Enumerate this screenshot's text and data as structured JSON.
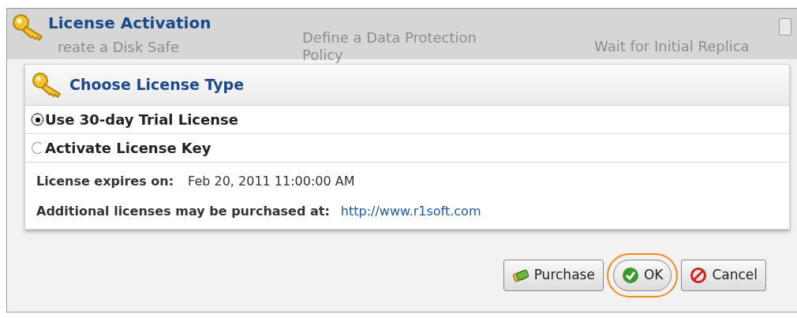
{
  "window": {
    "title": "License Activation"
  },
  "background_steps": [
    "reate a Disk Safe",
    "Define a Data Protection Policy",
    "Wait for Initial Replica"
  ],
  "panel": {
    "title": "Choose License Type",
    "options": [
      {
        "label": "Use 30-day Trial License",
        "selected": true
      },
      {
        "label": "Activate License Key",
        "selected": false
      }
    ],
    "expires_label": "License expires on:",
    "expires_value": "Feb 20, 2011 11:00:00 AM",
    "purchase_label": "Additional licenses may be purchased at:",
    "purchase_link": "http://www.r1soft.com"
  },
  "buttons": [
    {
      "kind": "purchase",
      "label": "Purchase",
      "highlighted": false
    },
    {
      "kind": "ok",
      "label": "OK",
      "highlighted": true
    },
    {
      "kind": "cancel",
      "label": "Cancel",
      "highlighted": false
    }
  ]
}
